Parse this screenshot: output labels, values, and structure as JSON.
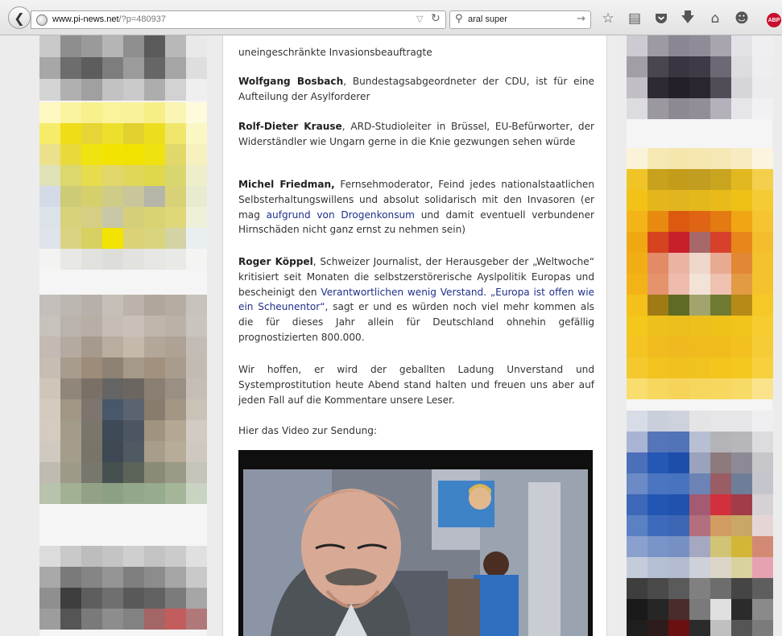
{
  "browser": {
    "back_icon": "back-arrow-icon",
    "url_domain": "www.pi-news.net",
    "url_path": "/?p=480937",
    "search_query": "aral super",
    "toolbar_icons": [
      "star-icon",
      "clipboard-icon",
      "pocket-icon",
      "download-icon",
      "home-icon",
      "chat-icon",
      "adblock-icon"
    ],
    "abp_label": "ABP"
  },
  "article": {
    "p0": "uneingeschränkte Invasionsbeauftragte",
    "p1": {
      "name": "Wolfgang Bosbach",
      "rest": ", Bundestagsabgeordneter der CDU, ist für eine Aufteilung der Asylforderer"
    },
    "p2": {
      "name": "Rolf-Dieter Krause",
      "rest": ", ARD-Studioleiter in Brüssel, EU-Befürworter, der Widerständler wie Ungarn gerne in die Knie gezwungen sehen würde"
    },
    "p3": {
      "name": "Michel Friedman,",
      "a": " Fernsehmoderator, Feind jedes nationalstaatlichen Selbsterhaltungswillens und absolut solidarisch mit den Invasoren (er mag ",
      "link": "aufgrund von Drogenkonsum",
      "b": " und damit eventuell verbundener Hirnschäden nicht ganz ernst zu nehmen sein)"
    },
    "p4": {
      "name": "Roger Köppel",
      "a": ", Schweizer Journalist, der Herausgeber der „Weltwoche“ kritisiert seit Monaten die selbstzerstörerische Ayslpolitik Europas und bescheinigt den ",
      "link1": "Verantwortlichen wenig Verstand.",
      "space": " ",
      "link2": "„Europa ist offen wie ein Scheunentor“",
      "b": ", sagt er und es würden noch viel mehr kommen als die für dieses Jahr allein für Deutschland ohnehin gefällig prognostizierten 800.000."
    },
    "p5": "Wir hoffen, er wird der geballten Ladung Unverstand und Systemprostitution heute Abend stand halten und freuen uns aber auf jeden Fall auf die Kommentare unsere Leser.",
    "p6": "Hier das Video zur Sendung:"
  },
  "colors": {
    "link": "#1f2f8a",
    "text": "#333333",
    "ad_yellow": "#f2d600",
    "ad_orange": "#e8a10c"
  }
}
